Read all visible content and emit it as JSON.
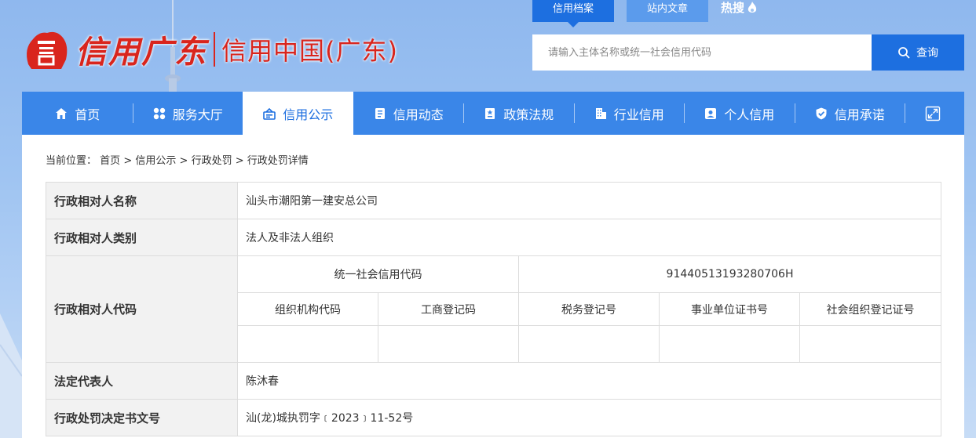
{
  "header": {
    "logo_brand": "信用广东",
    "logo_title": "信用中国(广东)",
    "top_tabs": [
      "信用档案",
      "站内文章"
    ],
    "hot_label": "热搜"
  },
  "search": {
    "placeholder": "请输入主体名称或统一社会信用代码",
    "button_label": "查询"
  },
  "nav": {
    "items": [
      {
        "label": "首页",
        "icon": "home-icon"
      },
      {
        "label": "服务大厅",
        "icon": "grid-icon"
      },
      {
        "label": "信用公示",
        "icon": "announcement-icon"
      },
      {
        "label": "信用动态",
        "icon": "news-icon"
      },
      {
        "label": "政策法规",
        "icon": "policy-icon"
      },
      {
        "label": "行业信用",
        "icon": "building-icon"
      },
      {
        "label": "个人信用",
        "icon": "id-card-icon"
      },
      {
        "label": "信用承诺",
        "icon": "shield-check-icon"
      }
    ],
    "active_index": 2,
    "expand_icon": "expand-icon"
  },
  "breadcrumb": {
    "prefix": "当前位置：",
    "items": [
      "首页",
      "信用公示",
      "行政处罚",
      "行政处罚详情"
    ],
    "separator": ">"
  },
  "detail": {
    "name_label": "行政相对人名称",
    "name_value": "汕头市潮阳第一建安总公司",
    "category_label": "行政相对人类别",
    "category_value": "法人及非法人组织",
    "code_label": "行政相对人代码",
    "uscc_label": "统一社会信用代码",
    "uscc_value": "91440513193280706H",
    "sub_headers": [
      "组织机构代码",
      "工商登记码",
      "税务登记号",
      "事业单位证书号",
      "社会组织登记证号"
    ],
    "sub_values": [
      "",
      "",
      "",
      "",
      ""
    ],
    "legal_rep_label": "法定代表人",
    "legal_rep_value": "陈沐春",
    "decision_no_label": "行政处罚决定书文号",
    "decision_no_value": "汕(龙)城执罚字﹝2023﹞11-52号"
  },
  "colors": {
    "primary": "#1d6fe0",
    "nav_bg": "#3a86e8",
    "brand_red": "#d9251d",
    "label_bg": "#f2f2f2"
  }
}
